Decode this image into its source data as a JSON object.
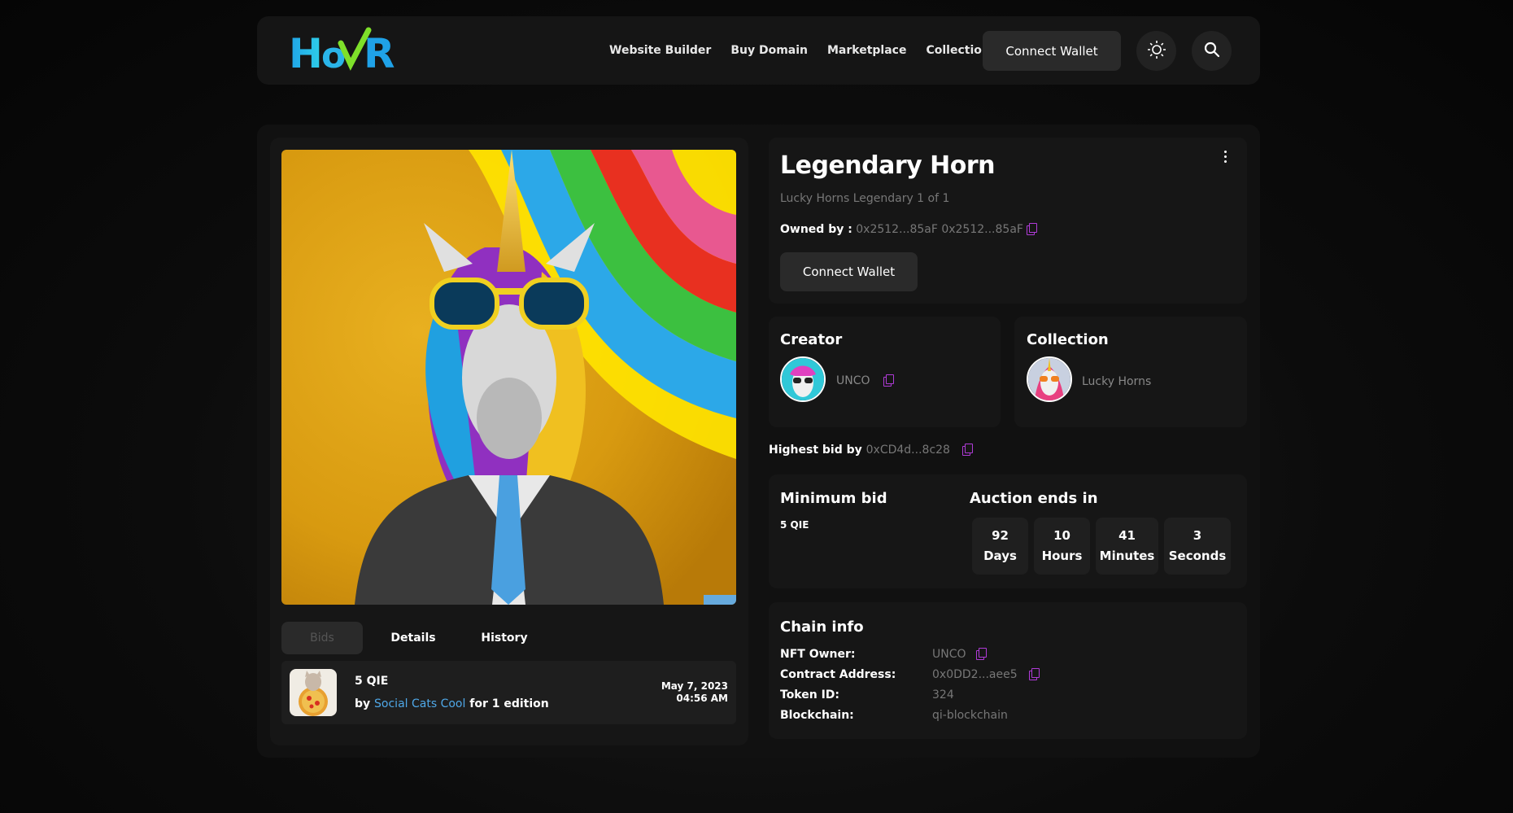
{
  "header": {
    "logo_text": "HovR",
    "nav": [
      "Website Builder",
      "Buy Domain",
      "Marketplace",
      "Collections"
    ],
    "connect_label": "Connect Wallet",
    "icons": [
      "sun-icon",
      "search-icon"
    ]
  },
  "nft": {
    "title": "Legendary Horn",
    "subtitle": "Lucky Horns Legendary 1 of 1",
    "owned_label": "Owned by :",
    "owned_value": "0x2512...85aF 0x2512...85aF",
    "connect_label": "Connect Wallet"
  },
  "creator": {
    "heading": "Creator",
    "name": "UNCO"
  },
  "collection": {
    "heading": "Collection",
    "name": "Lucky Horns"
  },
  "highest_bid": {
    "label": "Highest bid by",
    "value": "0xCD4d...8c28"
  },
  "minimum_bid": {
    "heading": "Minimum bid",
    "value": "5 QIE"
  },
  "auction": {
    "heading": "Auction ends in",
    "units": [
      {
        "value": "92",
        "label": "Days"
      },
      {
        "value": "10",
        "label": "Hours"
      },
      {
        "value": "41",
        "label": "Minutes"
      },
      {
        "value": "3",
        "label": "Seconds"
      }
    ]
  },
  "chain": {
    "heading": "Chain info",
    "rows": [
      {
        "label": "NFT Owner:",
        "value": "UNCO"
      },
      {
        "label": "Contract Address:",
        "value": "0x0DD2...aee5"
      },
      {
        "label": "Token ID:",
        "value": "324"
      },
      {
        "label": "Blockchain:",
        "value": "qi-blockchain"
      }
    ]
  },
  "tabs": [
    "Bids",
    "Details",
    "History"
  ],
  "bid": {
    "amount": "5 QIE",
    "by_prefix": "by",
    "bidder": "Social Cats Cool",
    "suffix": "for 1 edition",
    "date": "May 7, 2023",
    "time": "04:56 AM"
  },
  "colors": {
    "accent_copy": "#b03bd8",
    "link": "#4fa8e8",
    "logo_blue": "#1fa2e8",
    "logo_green": "#7ee02a"
  }
}
